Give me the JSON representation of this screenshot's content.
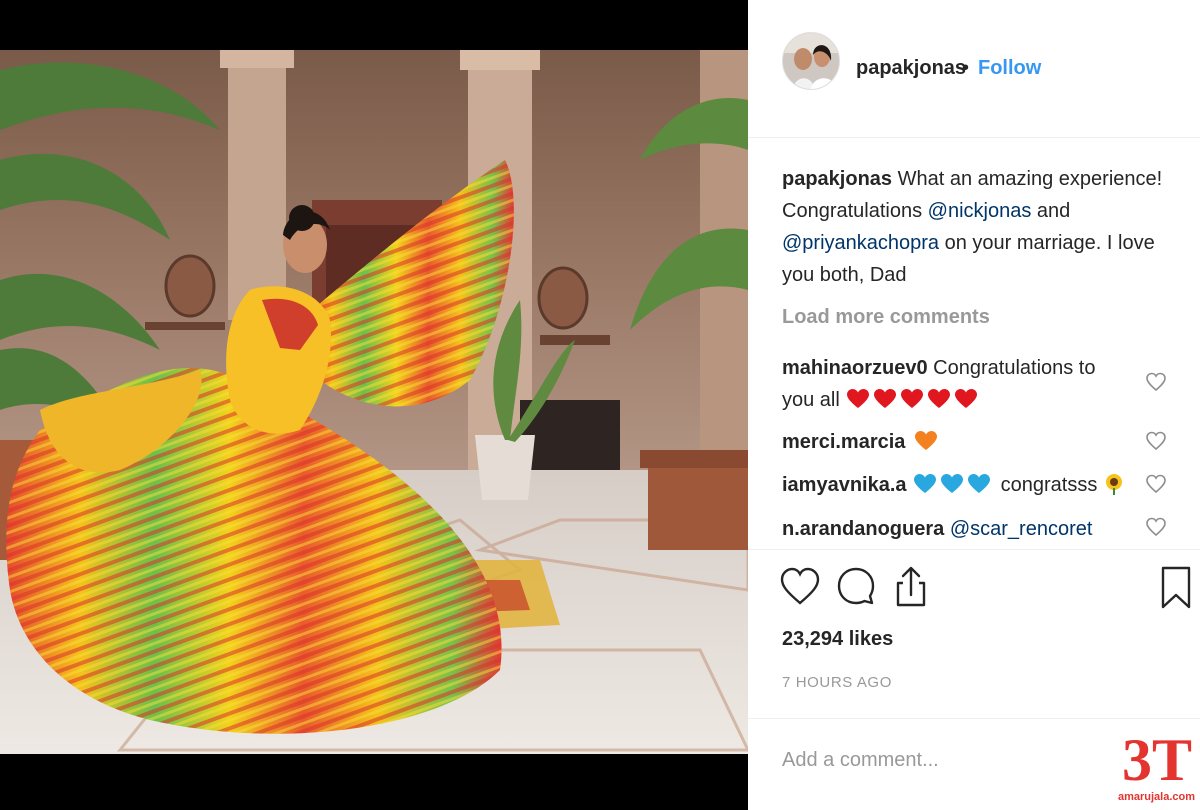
{
  "post": {
    "username": "papakjonas",
    "separator": "•",
    "follow_label": "Follow",
    "caption": {
      "username": "papakjonas",
      "text_1": " What an amazing experience! Congratulations ",
      "mention_1": "@nickjonas",
      "text_2": " and ",
      "mention_2": "@priyankachopra",
      "text_3": " on your marriage. I love you both, Dad"
    },
    "load_more_label": "Load more comments",
    "comments": [
      {
        "username": "mahinaorzuev0",
        "text": " Congratulations to you all",
        "emoji": "red-heart x5"
      },
      {
        "username": "merci.marcia",
        "text": "",
        "emoji": "orange-heart"
      },
      {
        "username": "iamyavnika.a",
        "text": " congratsss",
        "emoji": "blue-heart x3, sunflower"
      },
      {
        "username": "n.arandanoguera",
        "text": "",
        "mention": "@scar_rencoret"
      }
    ],
    "likes": "23,294 likes",
    "time": "7 HOURS AGO",
    "add_comment_placeholder": "Add a comment..."
  },
  "watermark": {
    "logo_text": "3T",
    "site": "amarujala.com"
  },
  "colors": {
    "link": "#3897f0",
    "mention": "#003569",
    "muted": "#999999",
    "text": "#262626",
    "brand": "#e3342f"
  },
  "icons": [
    "heart-icon",
    "comment-icon",
    "share-icon",
    "bookmark-icon",
    "small-heart-icon"
  ]
}
